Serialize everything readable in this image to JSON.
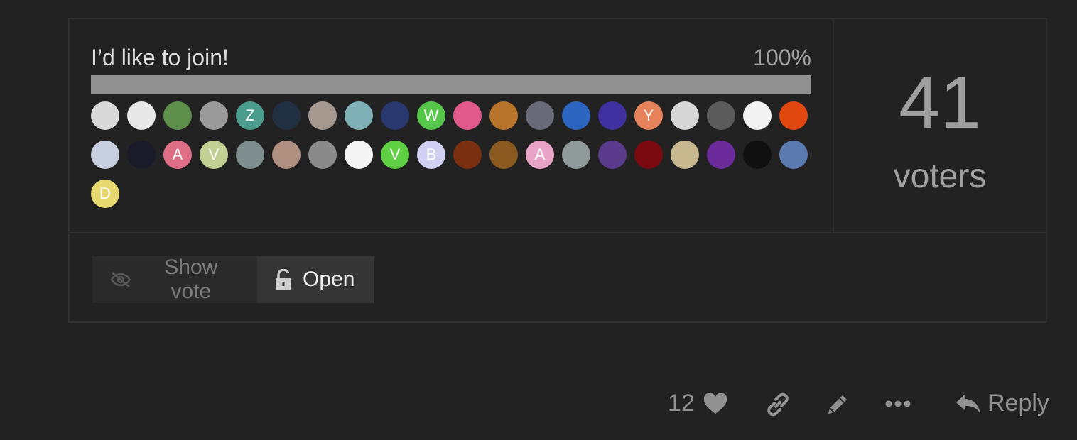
{
  "poll": {
    "option": {
      "label": "I’d like to join!",
      "percent_label": "100%",
      "percent": 100
    },
    "voters": {
      "count": "41",
      "label": "voters"
    },
    "avatars": [
      {
        "bg": "#d9d9d9",
        "letter": ""
      },
      {
        "bg": "#e8e8e8",
        "letter": ""
      },
      {
        "bg": "#5d8f4a",
        "letter": ""
      },
      {
        "bg": "#9a9a9a",
        "letter": ""
      },
      {
        "bg": "#4a9c8c",
        "letter": "Z"
      },
      {
        "bg": "#203040",
        "letter": ""
      },
      {
        "bg": "#a69a90",
        "letter": ""
      },
      {
        "bg": "#7fb0b6",
        "letter": ""
      },
      {
        "bg": "#2a3870",
        "letter": ""
      },
      {
        "bg": "#55c64a",
        "letter": "W"
      },
      {
        "bg": "#e25a8c",
        "letter": ""
      },
      {
        "bg": "#b8742a",
        "letter": ""
      },
      {
        "bg": "#6a6a7a",
        "letter": ""
      },
      {
        "bg": "#2c66c0",
        "letter": ""
      },
      {
        "bg": "#4030a0",
        "letter": ""
      },
      {
        "bg": "#e7835b",
        "letter": "Y"
      },
      {
        "bg": "#d6d6d6",
        "letter": ""
      },
      {
        "bg": "#5b5b5b",
        "letter": ""
      },
      {
        "bg": "#f2f2f2",
        "letter": ""
      },
      {
        "bg": "#e04810",
        "letter": ""
      },
      {
        "bg": "#c8d0e0",
        "letter": ""
      },
      {
        "bg": "#1a1a28",
        "letter": ""
      },
      {
        "bg": "#dd6e86",
        "letter": "A"
      },
      {
        "bg": "#c3d093",
        "letter": "V"
      },
      {
        "bg": "#7f8f8f",
        "letter": ""
      },
      {
        "bg": "#b09080",
        "letter": ""
      },
      {
        "bg": "#8a8a8a",
        "letter": ""
      },
      {
        "bg": "#f4f4f4",
        "letter": ""
      },
      {
        "bg": "#5fcf44",
        "letter": "V"
      },
      {
        "bg": "#d2d0f2",
        "letter": "B"
      },
      {
        "bg": "#7a3010",
        "letter": ""
      },
      {
        "bg": "#8a5a20",
        "letter": ""
      },
      {
        "bg": "#e8a4c6",
        "letter": "A"
      },
      {
        "bg": "#909a9a",
        "letter": ""
      },
      {
        "bg": "#5a3a8a",
        "letter": ""
      },
      {
        "bg": "#7a0a10",
        "letter": ""
      },
      {
        "bg": "#c8b890",
        "letter": ""
      },
      {
        "bg": "#6a2a9a",
        "letter": ""
      },
      {
        "bg": "#101010",
        "letter": ""
      },
      {
        "bg": "#5a7ab0",
        "letter": ""
      },
      {
        "bg": "#e6d76e",
        "letter": "D"
      }
    ],
    "controls": {
      "show_vote": "Show vote",
      "open": "Open"
    }
  },
  "post_actions": {
    "like_count": "12",
    "reply_label": "Reply",
    "icons": [
      "heart-icon",
      "link-icon",
      "pencil-icon",
      "more-icon",
      "reply-icon"
    ]
  },
  "colors": {
    "background": "#222222",
    "border": "#303030",
    "bar": "#919191",
    "muted": "#919191"
  }
}
